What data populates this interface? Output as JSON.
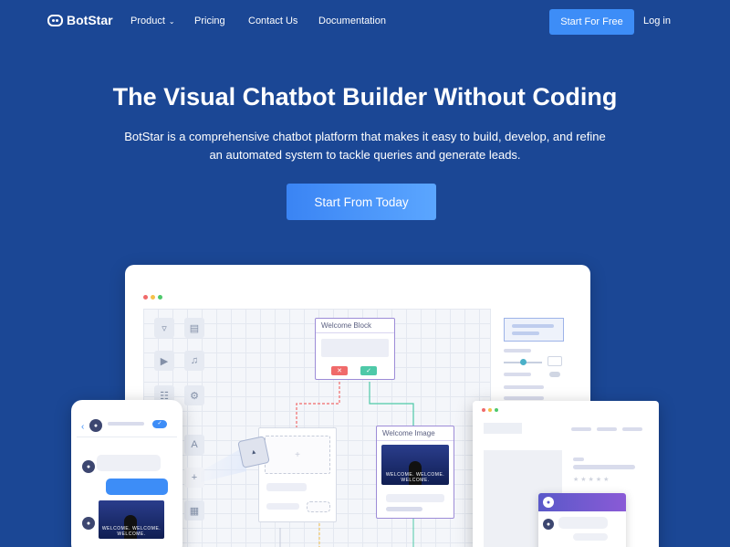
{
  "nav": {
    "logo_text": "BotStar",
    "product": "Product",
    "pricing": "Pricing",
    "contact": "Contact Us",
    "docs": "Documentation",
    "start_free": "Start For Free",
    "login": "Log in"
  },
  "hero": {
    "title": "The Visual Chatbot Builder Without Coding",
    "subtitle_line1": "BotStar is a comprehensive chatbot platform that makes it easy to build, develop, and refine",
    "subtitle_line2": "an automated system to tackle queries and generate leads.",
    "cta": "Start From Today"
  },
  "builder": {
    "welcome_block": "Welcome Block",
    "welcome_image": "Welcome Image",
    "video_caption": "WELCOME. WELCOME. WELCOME."
  },
  "icons": [
    "chevron-down-icon",
    "close-icon",
    "check-icon",
    "plus-icon",
    "play-icon",
    "speaker-icon",
    "cart-icon",
    "translate-icon",
    "robot-icon",
    "back-icon"
  ],
  "colors": {
    "background": "#1b4795",
    "accent": "#3d8df7",
    "block_border": "#9d8cd7",
    "reject": "#f06a6a",
    "accept": "#4ec9a8"
  }
}
